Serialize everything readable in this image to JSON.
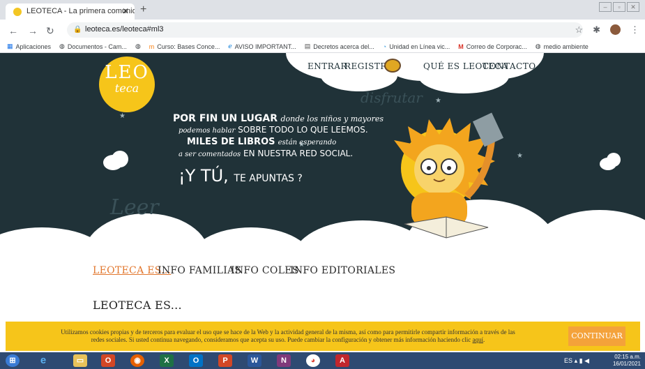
{
  "browser": {
    "tab_title": "LEOTECA - La primera comunida",
    "url": "leoteca.es/leoteca#ml3",
    "bookmarks": [
      {
        "label": "Aplicaciones",
        "icon": "apps-grid-icon"
      },
      {
        "label": "Documentos - Cam...",
        "icon": "globe-icon"
      },
      {
        "label": "",
        "icon": "globe-icon"
      },
      {
        "label": "Curso: Bases Conce...",
        "icon": "moodle-icon"
      },
      {
        "label": "AVISO IMPORTANT...",
        "icon": "edge-icon"
      },
      {
        "label": "Decretos acerca del...",
        "icon": "doc-icon"
      },
      {
        "label": "Unidad en Línea vic...",
        "icon": "unidad-icon"
      },
      {
        "label": "Correo de Corporac...",
        "icon": "gmail-icon"
      },
      {
        "label": "medio ambiente",
        "icon": "globe-icon"
      }
    ]
  },
  "site": {
    "logo_line1": "LEO",
    "logo_line2": "teca",
    "nav": {
      "entrar": "ENTRAR",
      "registro": "REGISTRO",
      "que_es": "QUÉ ES LEOTECA",
      "contacto": "CONTACTO"
    },
    "script_words": {
      "disfrutar": "disfrutar",
      "leer": "Leer"
    },
    "tagline": {
      "l1a": "POR FIN UN LUGAR",
      "l1b": "donde los niños y mayores",
      "l2a": "podemos hablar",
      "l2b": "SOBRE TODO LO QUE LEEMOS.",
      "l3a": "MILES DE LIBROS",
      "l3b": "están esperando",
      "l4a": "a ser comentados",
      "l4b": "EN NUESTRA RED SOCIAL.",
      "l5a": "¡Y TÚ,",
      "l5b": "TE APUNTAS ?"
    },
    "menu": {
      "item1": "LEOTECA ES...",
      "item2": "INFO FAMILIAS",
      "item3": "INFO COLES",
      "item4": "INFO EDITORIALES"
    },
    "section_title": "LEOTECA ES...",
    "cookie": {
      "text_line1": "Utilizamos cookies propias y de terceros para evaluar el uso que se hace de la Web y la actividad general de la misma, así como para permitirle compartir información a través de las",
      "text_line2": "redes sociales. Si usted continua navegando, consideramos que acepta su uso. Puede cambiar la configuración y obtener más información haciendo clic",
      "link": "aquí",
      "button": "CONTINUAR"
    }
  },
  "taskbar": {
    "lang": "ES",
    "time": "02:15 a.m.",
    "date": "16/01/2021"
  }
}
